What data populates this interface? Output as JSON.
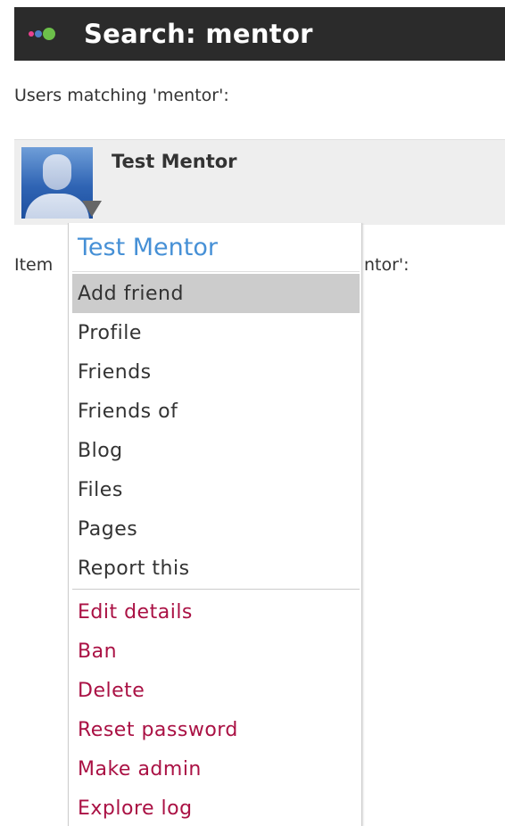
{
  "header": {
    "title": "Search: mentor"
  },
  "users_heading": "Users matching 'mentor':",
  "user": {
    "name": "Test Mentor"
  },
  "items_heading_start": "Item",
  "items_heading_end": "ntor':",
  "menu": {
    "title": "Test Mentor",
    "items": [
      {
        "label": "Add friend",
        "state": "hovered"
      },
      {
        "label": "Profile"
      },
      {
        "label": "Friends"
      },
      {
        "label": "Friends of"
      },
      {
        "label": "Blog"
      },
      {
        "label": "Files"
      },
      {
        "label": "Pages"
      },
      {
        "label": "Report this"
      }
    ],
    "admin_items": [
      {
        "label": "Edit details"
      },
      {
        "label": "Ban"
      },
      {
        "label": "Delete"
      },
      {
        "label": "Reset password"
      },
      {
        "label": "Make admin"
      },
      {
        "label": "Explore log"
      }
    ]
  },
  "colors": {
    "header_bg": "#2b2b2b",
    "menu_title": "#4690d6",
    "admin_link": "#aa1144",
    "hover_bg": "#cccccc",
    "user_row_bg": "#eeeeee"
  }
}
